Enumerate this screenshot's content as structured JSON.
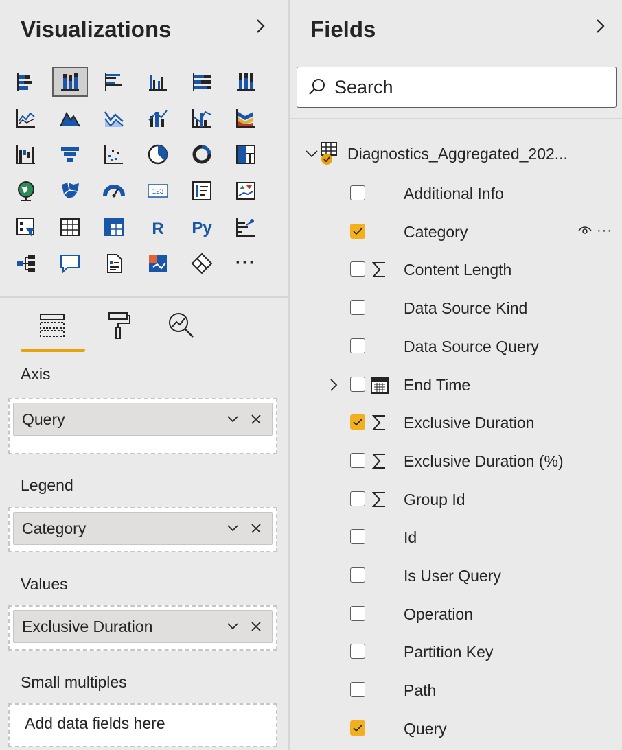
{
  "visualizations": {
    "title": "Visualizations",
    "axis_label": "Axis",
    "axis_field": "Query",
    "legend_label": "Legend",
    "legend_field": "Category",
    "values_label": "Values",
    "values_field": "Exclusive Duration",
    "small_multiples_label": "Small multiples",
    "small_multiples_placeholder": "Add data fields here",
    "more_visuals": "···",
    "r_visual": "R",
    "py_visual": "Py",
    "card_visual": "123"
  },
  "fields": {
    "title": "Fields",
    "search_placeholder": "Search",
    "table_name": "Diagnostics_Aggregated_202...",
    "items": [
      {
        "label": "Additional Info",
        "checked": false,
        "type": ""
      },
      {
        "label": "Category",
        "checked": true,
        "type": ""
      },
      {
        "label": "Content Length",
        "checked": false,
        "type": "sum"
      },
      {
        "label": "Data Source Kind",
        "checked": false,
        "type": ""
      },
      {
        "label": "Data Source Query",
        "checked": false,
        "type": ""
      },
      {
        "label": "End Time",
        "checked": false,
        "type": "date"
      },
      {
        "label": "Exclusive Duration",
        "checked": true,
        "type": "sum"
      },
      {
        "label": "Exclusive Duration (%)",
        "checked": false,
        "type": "sum"
      },
      {
        "label": "Group Id",
        "checked": false,
        "type": "sum"
      },
      {
        "label": "Id",
        "checked": false,
        "type": ""
      },
      {
        "label": "Is User Query",
        "checked": false,
        "type": ""
      },
      {
        "label": "Operation",
        "checked": false,
        "type": ""
      },
      {
        "label": "Partition Key",
        "checked": false,
        "type": ""
      },
      {
        "label": "Path",
        "checked": false,
        "type": ""
      },
      {
        "label": "Query",
        "checked": true,
        "type": ""
      }
    ],
    "row_more": "···"
  },
  "colors": {
    "accent": "#f2b01e",
    "brand_blue": "#1a56a8",
    "background": "#ebeaea"
  }
}
